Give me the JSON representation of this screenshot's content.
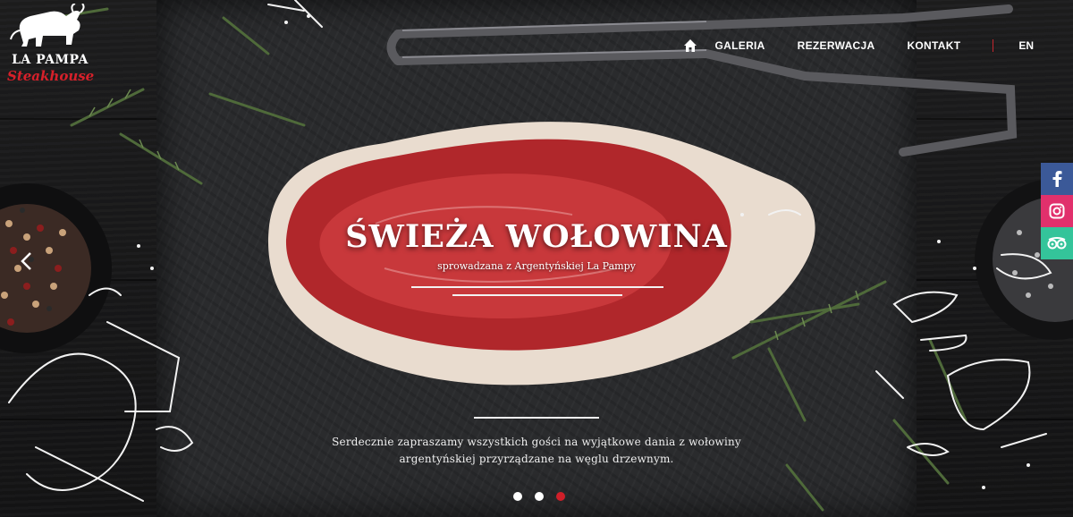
{
  "logo": {
    "top": "LA PAMPA",
    "bottom": "Steakhouse"
  },
  "nav": {
    "home_icon": "home-icon",
    "items": [
      "GALERIA",
      "REZERWACJA",
      "KONTAKT"
    ],
    "lang": "EN"
  },
  "social": [
    "facebook-icon",
    "instagram-icon",
    "tripadvisor-icon"
  ],
  "hero": {
    "title": "ŚWIEŻA WOŁOWINA",
    "subtitle": "sprowadzana z Argentyńskiej La Pampy",
    "description_line1": "Serdecznie zapraszamy wszystkich gości na wyjątkowe dania z wołowiny",
    "description_line2": "argentyńskiej przyrządzane na węglu drzewnym."
  },
  "slider": {
    "total": 3,
    "active_index": 3
  },
  "colors": {
    "accent": "#d01f29",
    "facebook": "#3b5998",
    "instagram": "#e1306c",
    "tripadvisor": "#34c49a"
  }
}
